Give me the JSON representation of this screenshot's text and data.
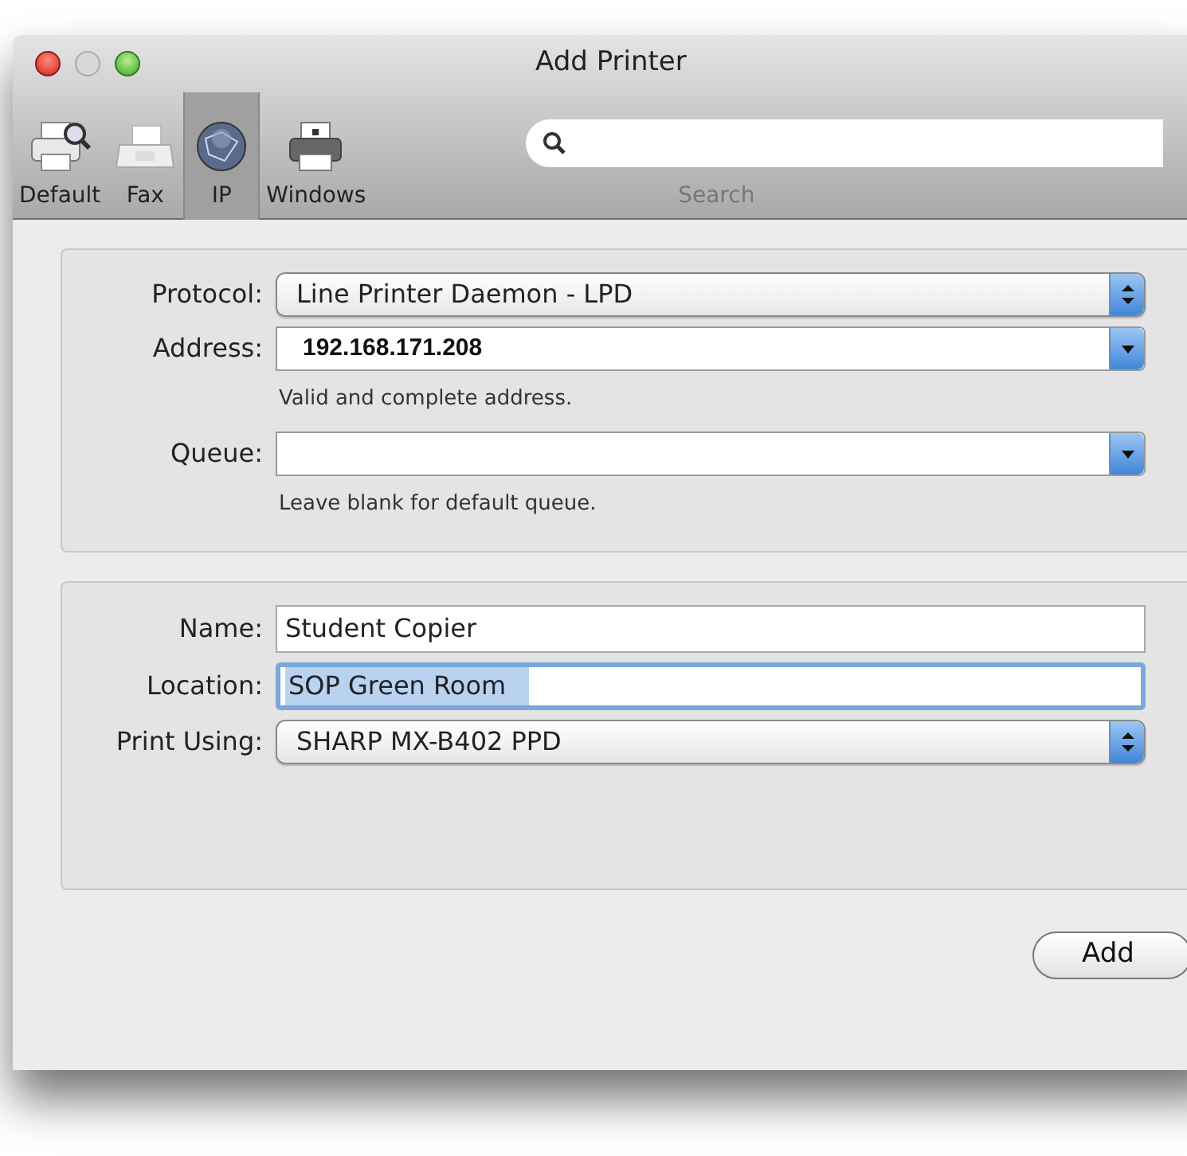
{
  "window": {
    "title": "Add Printer"
  },
  "toolbar": {
    "items": [
      {
        "label": "Default",
        "selected": false
      },
      {
        "label": "Fax",
        "selected": false
      },
      {
        "label": "IP",
        "selected": true
      },
      {
        "label": "Windows",
        "selected": false
      }
    ],
    "search": {
      "label": "Search"
    }
  },
  "groups": [
    {
      "rows": [
        {
          "label": "Protocol:",
          "kind": "popup",
          "value": "Line Printer Daemon - LPD"
        },
        {
          "label": "Address:",
          "kind": "combo",
          "value": "192.168.171.208",
          "hint": "Valid and complete address."
        },
        {
          "label": "Queue:",
          "kind": "combo",
          "hint": "Leave blank for default queue."
        }
      ]
    },
    {
      "rows": [
        {
          "label": "Name:",
          "kind": "text",
          "value": "Student Copier",
          "focused": false
        },
        {
          "label": "Location:",
          "kind": "text",
          "value": "SOP Green Room",
          "focused": true
        },
        {
          "label": "Print Using:",
          "kind": "popup",
          "value": "SHARP MX-B402 PPD"
        }
      ]
    }
  ],
  "buttons": [
    {
      "label": "Add"
    }
  ]
}
